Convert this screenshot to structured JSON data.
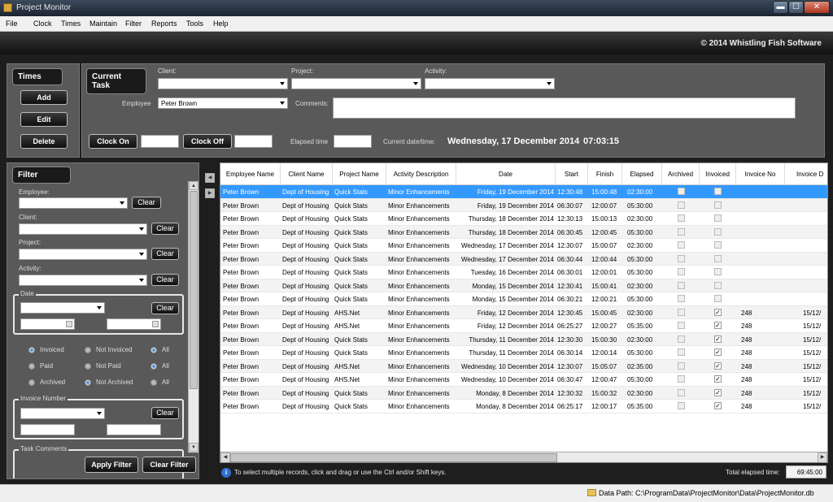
{
  "window": {
    "title": "Project Monitor",
    "min": "▬",
    "max": "☐",
    "close": "✕"
  },
  "menu": [
    "File",
    "Clock",
    "Times",
    "Maintain",
    "Filter",
    "Reports",
    "Tools",
    "Help"
  ],
  "banner": {
    "copyright": "© 2014 Whistling Fish Software"
  },
  "times_panel": {
    "title": "Times",
    "add": "Add",
    "edit": "Edit",
    "delete": "Delete"
  },
  "current_task": {
    "title": "Current Task",
    "client_label": "Client:",
    "project_label": "Project:",
    "activity_label": "Activity:",
    "employee_label": "Employee",
    "employee_value": "Peter Brown",
    "comments_label": "Comments:",
    "clock_on": "Clock On",
    "clock_off": "Clock Off",
    "elapsed_label": "Elapsed time",
    "current_dt_label": "Current date/time:",
    "current_date": "Wednesday, 17 December 2014",
    "current_time": "07:03:15"
  },
  "filter": {
    "title": "Filter",
    "employee_label": "Employee:",
    "client_label": "Client:",
    "project_label": "Project:",
    "activity_label": "Activity:",
    "date_label": "Date",
    "clear": "Clear",
    "invoice_number_label": "Invoice Number",
    "task_comments_label": "Task Comments",
    "apply": "Apply Filter",
    "clear_filter": "Clear Filter",
    "radios": [
      [
        {
          "label": "Invoiced",
          "state": "on"
        },
        {
          "label": "Not Invoiced",
          "state": "off"
        },
        {
          "label": "All",
          "state": "on"
        }
      ],
      [
        {
          "label": "Paid",
          "state": "off"
        },
        {
          "label": "Not Paid",
          "state": "off"
        },
        {
          "label": "All",
          "state": "on"
        }
      ],
      [
        {
          "label": "Archived",
          "state": "off"
        },
        {
          "label": "Not Archived",
          "state": "on"
        },
        {
          "label": "All",
          "state": "off"
        }
      ]
    ]
  },
  "grid": {
    "columns": [
      "Employee Name",
      "Client Name",
      "Project Name",
      "Activity Description",
      "Date",
      "Start",
      "Finish",
      "Elapsed",
      "Archived",
      "Invoiced",
      "Invoice No",
      "Invoice D"
    ],
    "rows": [
      {
        "emp": "Peter Brown",
        "client": "Dept of Housing",
        "project": "Quick Stats",
        "activity": "Minor Enhancements",
        "date": "Friday, 19 December 2014",
        "start": "12:30:48",
        "finish": "15:00:48",
        "elapsed": "02:30:00",
        "archived": false,
        "invoiced": false,
        "inv_no": "",
        "inv_date": ""
      },
      {
        "emp": "Peter Brown",
        "client": "Dept of Housing",
        "project": "Quick Stats",
        "activity": "Minor Enhancements",
        "date": "Friday, 19 December 2014",
        "start": "06:30:07",
        "finish": "12:00:07",
        "elapsed": "05:30:00",
        "archived": false,
        "invoiced": false,
        "inv_no": "",
        "inv_date": ""
      },
      {
        "emp": "Peter Brown",
        "client": "Dept of Housing",
        "project": "Quick Stats",
        "activity": "Minor Enhancements",
        "date": "Thursday, 18 December 2014",
        "start": "12:30:13",
        "finish": "15:00:13",
        "elapsed": "02:30:00",
        "archived": false,
        "invoiced": false,
        "inv_no": "",
        "inv_date": ""
      },
      {
        "emp": "Peter Brown",
        "client": "Dept of Housing",
        "project": "Quick Stats",
        "activity": "Minor Enhancements",
        "date": "Thursday, 18 December 2014",
        "start": "06:30:45",
        "finish": "12:00:45",
        "elapsed": "05:30:00",
        "archived": false,
        "invoiced": false,
        "inv_no": "",
        "inv_date": ""
      },
      {
        "emp": "Peter Brown",
        "client": "Dept of Housing",
        "project": "Quick Stats",
        "activity": "Minor Enhancements",
        "date": "Wednesday, 17 December 2014",
        "start": "12:30:07",
        "finish": "15:00:07",
        "elapsed": "02:30:00",
        "archived": false,
        "invoiced": false,
        "inv_no": "",
        "inv_date": ""
      },
      {
        "emp": "Peter Brown",
        "client": "Dept of Housing",
        "project": "Quick Stats",
        "activity": "Minor Enhancements",
        "date": "Wednesday, 17 December 2014",
        "start": "06:30:44",
        "finish": "12:00:44",
        "elapsed": "05:30:00",
        "archived": false,
        "invoiced": false,
        "inv_no": "",
        "inv_date": ""
      },
      {
        "emp": "Peter Brown",
        "client": "Dept of Housing",
        "project": "Quick Stats",
        "activity": "Minor Enhancements",
        "date": "Tuesday, 16 December 2014",
        "start": "06:30:01",
        "finish": "12:00:01",
        "elapsed": "05:30:00",
        "archived": false,
        "invoiced": false,
        "inv_no": "",
        "inv_date": ""
      },
      {
        "emp": "Peter Brown",
        "client": "Dept of Housing",
        "project": "Quick Stats",
        "activity": "Minor Enhancements",
        "date": "Monday, 15 December 2014",
        "start": "12:30:41",
        "finish": "15:00:41",
        "elapsed": "02:30:00",
        "archived": false,
        "invoiced": false,
        "inv_no": "",
        "inv_date": ""
      },
      {
        "emp": "Peter Brown",
        "client": "Dept of Housing",
        "project": "Quick Stats",
        "activity": "Minor Enhancements",
        "date": "Monday, 15 December 2014",
        "start": "06:30:21",
        "finish": "12:00:21",
        "elapsed": "05:30:00",
        "archived": false,
        "invoiced": false,
        "inv_no": "",
        "inv_date": ""
      },
      {
        "emp": "Peter Brown",
        "client": "Dept of Housing",
        "project": "AHS.Net",
        "activity": "Minor Enhancements",
        "date": "Friday, 12 December 2014",
        "start": "12:30:45",
        "finish": "15:00:45",
        "elapsed": "02:30:00",
        "archived": false,
        "invoiced": true,
        "inv_no": "248",
        "inv_date": "15/12/"
      },
      {
        "emp": "Peter Brown",
        "client": "Dept of Housing",
        "project": "AHS.Net",
        "activity": "Minor Enhancements",
        "date": "Friday, 12 December 2014",
        "start": "06:25:27",
        "finish": "12:00:27",
        "elapsed": "05:35:00",
        "archived": false,
        "invoiced": true,
        "inv_no": "248",
        "inv_date": "15/12/"
      },
      {
        "emp": "Peter Brown",
        "client": "Dept of Housing",
        "project": "Quick Stats",
        "activity": "Minor Enhancements",
        "date": "Thursday, 11 December 2014",
        "start": "12:30:30",
        "finish": "15:00:30",
        "elapsed": "02:30:00",
        "archived": false,
        "invoiced": true,
        "inv_no": "248",
        "inv_date": "15/12/"
      },
      {
        "emp": "Peter Brown",
        "client": "Dept of Housing",
        "project": "Quick Stats",
        "activity": "Minor Enhancements",
        "date": "Thursday, 11 December 2014",
        "start": "06:30:14",
        "finish": "12:00:14",
        "elapsed": "05:30:00",
        "archived": false,
        "invoiced": true,
        "inv_no": "248",
        "inv_date": "15/12/"
      },
      {
        "emp": "Peter Brown",
        "client": "Dept of Housing",
        "project": "AHS.Net",
        "activity": "Minor Enhancements",
        "date": "Wednesday, 10 December 2014",
        "start": "12:30:07",
        "finish": "15:05:07",
        "elapsed": "02:35:00",
        "archived": false,
        "invoiced": true,
        "inv_no": "248",
        "inv_date": "15/12/"
      },
      {
        "emp": "Peter Brown",
        "client": "Dept of Housing",
        "project": "AHS.Net",
        "activity": "Minor Enhancements",
        "date": "Wednesday, 10 December 2014",
        "start": "06:30:47",
        "finish": "12:00:47",
        "elapsed": "05:30:00",
        "archived": false,
        "invoiced": true,
        "inv_no": "248",
        "inv_date": "15/12/"
      },
      {
        "emp": "Peter Brown",
        "client": "Dept of Housing",
        "project": "Quick Stats",
        "activity": "Minor Enhancements",
        "date": "Monday, 8 December 2014",
        "start": "12:30:32",
        "finish": "15:00:32",
        "elapsed": "02:30:00",
        "archived": false,
        "invoiced": true,
        "inv_no": "248",
        "inv_date": "15/12/"
      },
      {
        "emp": "Peter Brown",
        "client": "Dept of Housing",
        "project": "Quick Stats",
        "activity": "Minor Enhancements",
        "date": "Monday, 8 December 2014",
        "start": "06:25:17",
        "finish": "12:00:17",
        "elapsed": "05:35:00",
        "archived": false,
        "invoiced": true,
        "inv_no": "248",
        "inv_date": "15/12/"
      }
    ],
    "selected_row": 0
  },
  "footer": {
    "info_text": "To select multiple records, click and drag or use the Ctrl and/or Shift keys.",
    "total_label": "Total elapsed time:",
    "total_value": "69:45:00"
  },
  "statusbar": {
    "data_path": "Data Path: C:\\ProgramData\\ProjectMonitor\\Data\\ProjectMonitor.db"
  },
  "colors": {
    "panel": "#595959",
    "selection": "#3399ff",
    "background": "#1e1e1e"
  },
  "icons": {
    "info": "info-icon",
    "folder": "folder-icon"
  }
}
